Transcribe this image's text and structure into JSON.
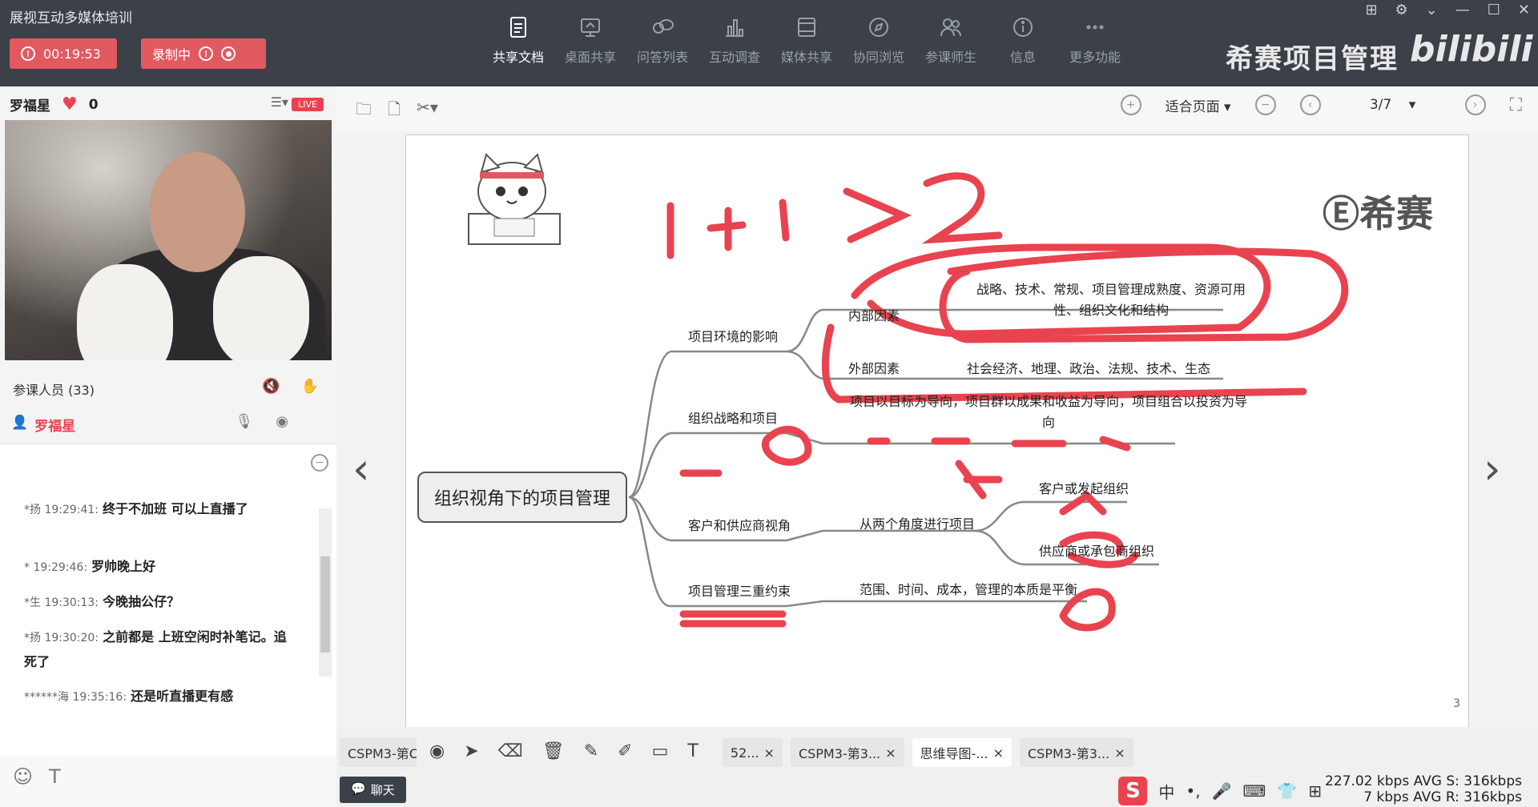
{
  "app": {
    "title": "展视互动多媒体培训",
    "timer": "00:19:53",
    "recording_label": "录制中",
    "brand_text": "希赛项目管理",
    "bili_text": "bilibili"
  },
  "toolbar": [
    {
      "label": "共享文档",
      "icon": "document-icon"
    },
    {
      "label": "桌面共享",
      "icon": "desktop-share-icon"
    },
    {
      "label": "问答列表",
      "icon": "qa-list-icon"
    },
    {
      "label": "互动调查",
      "icon": "survey-icon"
    },
    {
      "label": "媒体共享",
      "icon": "media-share-icon"
    },
    {
      "label": "协同浏览",
      "icon": "co-browse-icon"
    },
    {
      "label": "参课师生",
      "icon": "participants-icon"
    },
    {
      "label": "信息",
      "icon": "info-icon"
    },
    {
      "label": "更多功能",
      "icon": "more-icon"
    }
  ],
  "host": {
    "name": "罗福星",
    "likes": "0",
    "live_badge": "LIVE",
    "participants_label": "参课人员 (33)",
    "presenter_name": "罗福星"
  },
  "chat": {
    "messages": [
      {
        "who": "*扬 19:29:41:",
        "text": "终于不加班  可以上直播了"
      },
      {
        "who": "* 19:29:46:",
        "text": "罗帅晚上好"
      },
      {
        "who": "*生 19:30:13:",
        "text": "今晚抽公仔？"
      },
      {
        "who": "*扬 19:30:20:",
        "text": "之前都是  上班空闲时补笔记。追死了"
      },
      {
        "who": "******海 19:35:16:",
        "text": "还是听直播更有感"
      }
    ],
    "chat_tab_label": "聊天"
  },
  "doc_toolbar": {
    "zoom_label": "适合页面",
    "page_indicator": "3/7"
  },
  "slide": {
    "logo_text": "希赛",
    "page_number": "3",
    "center_title": "组织视角下的项目管理",
    "branches": {
      "env": "项目环境的影响",
      "internal": "内部因素",
      "internal_detail": "战略、技术、常规、项目管理成熟度、资源可用性、组织文化和结构",
      "external": "外部因素",
      "external_detail": "社会经济、地理、政治、法规、技术、生态",
      "strategy": "组织战略和项目",
      "strategy_detail": "项目以目标为导向，项目群以成果和收益为导向，项目组合以投资为导向",
      "customer": "客户和供应商视角",
      "customer_detail": "从两个角度进行项目",
      "customer_org": "客户或发起组织",
      "supplier_org": "供应商或承包商组织",
      "constraint": "项目管理三重约束",
      "constraint_detail": "范围、时间、成本，管理的本质是平衡"
    },
    "handwriting": "1+1>2"
  },
  "bottom": {
    "tabs": [
      {
        "label": "CSPM3-第C",
        "active": false
      },
      {
        "label": "52...",
        "active": false
      },
      {
        "label": "CSPM3-第3...",
        "active": false
      },
      {
        "label": "思维导图-...",
        "active": true
      },
      {
        "label": "CSPM3-第3...",
        "active": false
      }
    ],
    "stats_line1": "227.02 kbps   AVG S: 316kbps",
    "stats_line2": "7 kbps   AVG R: 316kbps",
    "ime_label": "中"
  },
  "colors": {
    "accent_red": "#e05a5f",
    "annotation_red": "#e8434f",
    "topbar_bg": "#3b4049"
  }
}
